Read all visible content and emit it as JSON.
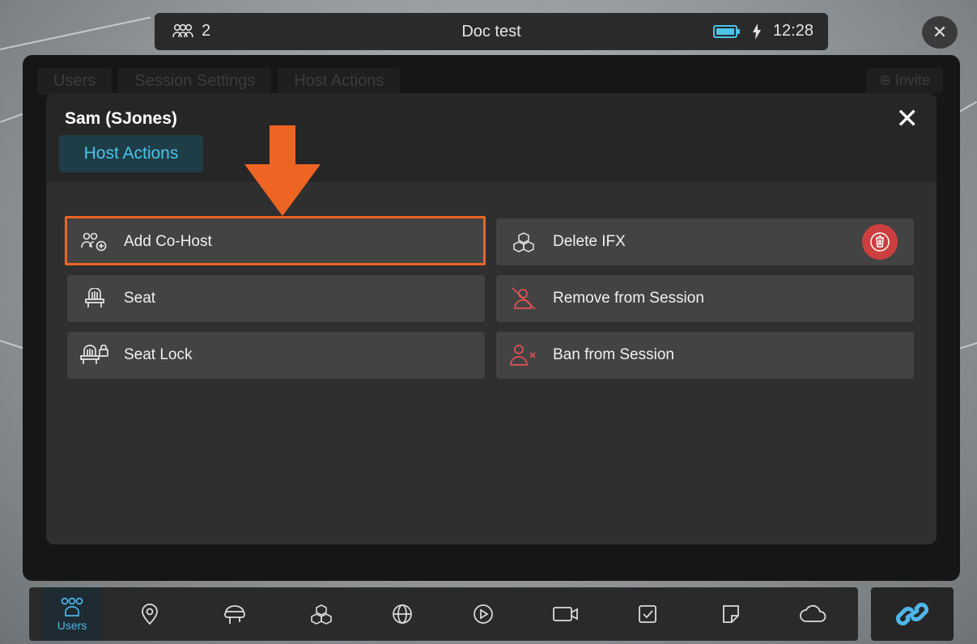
{
  "top_bar": {
    "user_count": "2",
    "title": "Doc test",
    "time": "12:28"
  },
  "background_tabs": [
    "Users",
    "Session Settings",
    "Host Actions"
  ],
  "background_invite": "Invite",
  "modal": {
    "user_name": "Sam (SJones)",
    "tab_label": "Host Actions",
    "actions_left": [
      {
        "label": "Add Co-Host",
        "icon": "add-cohost-icon"
      },
      {
        "label": "Seat",
        "icon": "seat-icon"
      },
      {
        "label": "Seat Lock",
        "icon": "seat-lock-icon"
      }
    ],
    "actions_right": [
      {
        "label": "Delete IFX",
        "icon": "cubes-icon"
      },
      {
        "label": "Remove from Session",
        "icon": "remove-user-icon"
      },
      {
        "label": "Ban from Session",
        "icon": "ban-user-icon"
      }
    ]
  },
  "bottom_nav": {
    "users_label": "Users",
    "items": [
      "users-icon",
      "location-pin-icon",
      "headset-icon",
      "cubes-icon",
      "globe-icon",
      "play-icon",
      "video-camera-icon",
      "checkbox-icon",
      "note-icon",
      "cloud-icon"
    ]
  },
  "colors": {
    "accent": "#4cc3ea",
    "highlight": "#ee6423",
    "danger": "#e05252"
  }
}
